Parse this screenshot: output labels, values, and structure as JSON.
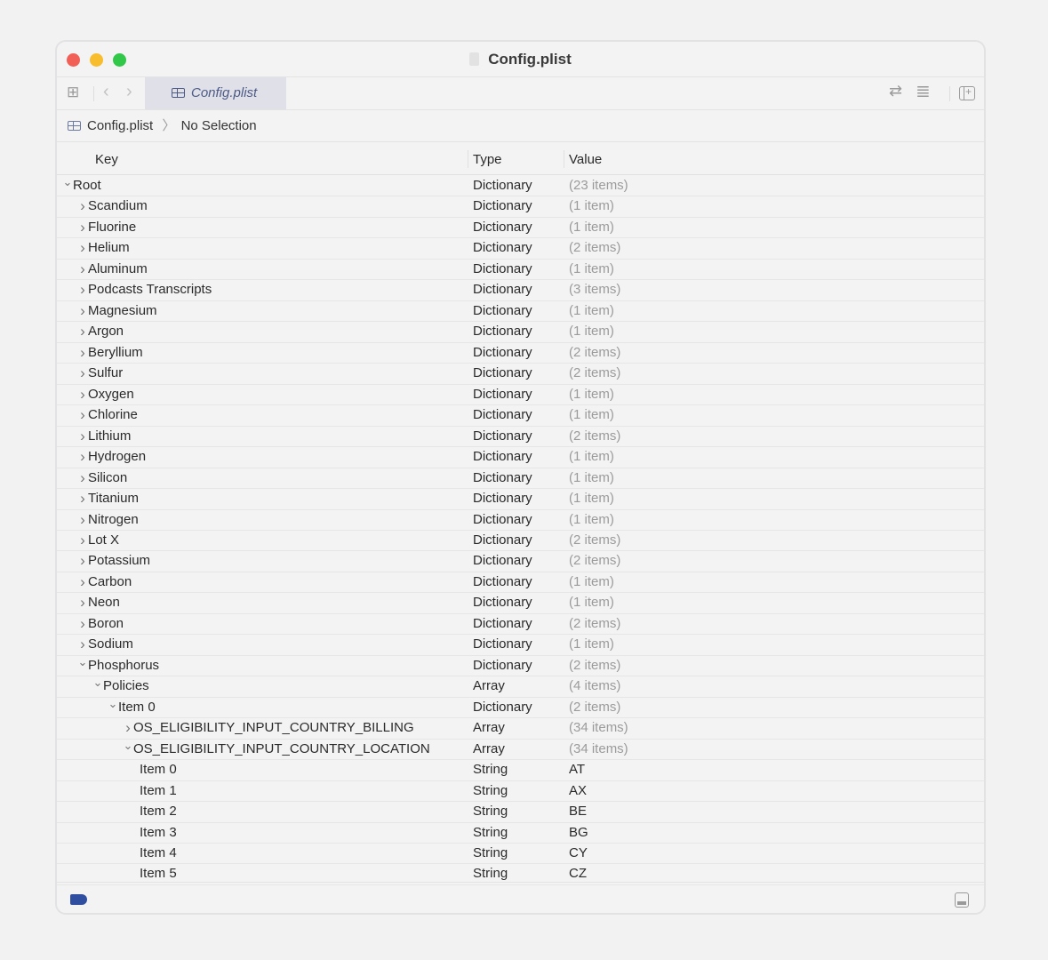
{
  "window": {
    "title": "Config.plist"
  },
  "toolbar": {
    "tab_label": "Config.plist"
  },
  "breadcrumb": {
    "file": "Config.plist",
    "separator": "〉",
    "selection": "No Selection"
  },
  "columns": {
    "key": "Key",
    "type": "Type",
    "value": "Value"
  },
  "rows": [
    {
      "key": "Root",
      "level": 0,
      "expand": "open",
      "type": "Dictionary",
      "value": "(23 items)",
      "muted": true
    },
    {
      "key": "Scandium",
      "level": 1,
      "expand": "closed",
      "type": "Dictionary",
      "value": "(1 item)",
      "muted": true
    },
    {
      "key": "Fluorine",
      "level": 1,
      "expand": "closed",
      "type": "Dictionary",
      "value": "(1 item)",
      "muted": true
    },
    {
      "key": "Helium",
      "level": 1,
      "expand": "closed",
      "type": "Dictionary",
      "value": "(2 items)",
      "muted": true
    },
    {
      "key": "Aluminum",
      "level": 1,
      "expand": "closed",
      "type": "Dictionary",
      "value": "(1 item)",
      "muted": true
    },
    {
      "key": "Podcasts Transcripts",
      "level": 1,
      "expand": "closed",
      "type": "Dictionary",
      "value": "(3 items)",
      "muted": true
    },
    {
      "key": "Magnesium",
      "level": 1,
      "expand": "closed",
      "type": "Dictionary",
      "value": "(1 item)",
      "muted": true
    },
    {
      "key": "Argon",
      "level": 1,
      "expand": "closed",
      "type": "Dictionary",
      "value": "(1 item)",
      "muted": true
    },
    {
      "key": "Beryllium",
      "level": 1,
      "expand": "closed",
      "type": "Dictionary",
      "value": "(2 items)",
      "muted": true
    },
    {
      "key": "Sulfur",
      "level": 1,
      "expand": "closed",
      "type": "Dictionary",
      "value": "(2 items)",
      "muted": true
    },
    {
      "key": "Oxygen",
      "level": 1,
      "expand": "closed",
      "type": "Dictionary",
      "value": "(1 item)",
      "muted": true
    },
    {
      "key": "Chlorine",
      "level": 1,
      "expand": "closed",
      "type": "Dictionary",
      "value": "(1 item)",
      "muted": true
    },
    {
      "key": "Lithium",
      "level": 1,
      "expand": "closed",
      "type": "Dictionary",
      "value": "(2 items)",
      "muted": true
    },
    {
      "key": "Hydrogen",
      "level": 1,
      "expand": "closed",
      "type": "Dictionary",
      "value": "(1 item)",
      "muted": true
    },
    {
      "key": "Silicon",
      "level": 1,
      "expand": "closed",
      "type": "Dictionary",
      "value": "(1 item)",
      "muted": true
    },
    {
      "key": "Titanium",
      "level": 1,
      "expand": "closed",
      "type": "Dictionary",
      "value": "(1 item)",
      "muted": true
    },
    {
      "key": "Nitrogen",
      "level": 1,
      "expand": "closed",
      "type": "Dictionary",
      "value": "(1 item)",
      "muted": true
    },
    {
      "key": "Lot X",
      "level": 1,
      "expand": "closed",
      "type": "Dictionary",
      "value": "(2 items)",
      "muted": true
    },
    {
      "key": "Potassium",
      "level": 1,
      "expand": "closed",
      "type": "Dictionary",
      "value": "(2 items)",
      "muted": true
    },
    {
      "key": "Carbon",
      "level": 1,
      "expand": "closed",
      "type": "Dictionary",
      "value": "(1 item)",
      "muted": true
    },
    {
      "key": "Neon",
      "level": 1,
      "expand": "closed",
      "type": "Dictionary",
      "value": "(1 item)",
      "muted": true
    },
    {
      "key": "Boron",
      "level": 1,
      "expand": "closed",
      "type": "Dictionary",
      "value": "(2 items)",
      "muted": true
    },
    {
      "key": "Sodium",
      "level": 1,
      "expand": "closed",
      "type": "Dictionary",
      "value": "(1 item)",
      "muted": true
    },
    {
      "key": "Phosphorus",
      "level": 1,
      "expand": "open",
      "type": "Dictionary",
      "value": "(2 items)",
      "muted": true
    },
    {
      "key": "Policies",
      "level": 2,
      "expand": "open",
      "type": "Array",
      "value": "(4 items)",
      "muted": true
    },
    {
      "key": "Item 0",
      "level": 3,
      "expand": "open",
      "type": "Dictionary",
      "value": "(2 items)",
      "muted": true
    },
    {
      "key": "OS_ELIGIBILITY_INPUT_COUNTRY_BILLING",
      "level": 4,
      "expand": "closed",
      "type": "Array",
      "value": "(34 items)",
      "muted": true
    },
    {
      "key": "OS_ELIGIBILITY_INPUT_COUNTRY_LOCATION",
      "level": 4,
      "expand": "open",
      "type": "Array",
      "value": "(34 items)",
      "muted": true
    },
    {
      "key": "Item 0",
      "level": 5,
      "expand": "none",
      "type": "String",
      "value": "AT",
      "muted": false
    },
    {
      "key": "Item 1",
      "level": 5,
      "expand": "none",
      "type": "String",
      "value": "AX",
      "muted": false
    },
    {
      "key": "Item 2",
      "level": 5,
      "expand": "none",
      "type": "String",
      "value": "BE",
      "muted": false
    },
    {
      "key": "Item 3",
      "level": 5,
      "expand": "none",
      "type": "String",
      "value": "BG",
      "muted": false
    },
    {
      "key": "Item 4",
      "level": 5,
      "expand": "none",
      "type": "String",
      "value": "CY",
      "muted": false
    },
    {
      "key": "Item 5",
      "level": 5,
      "expand": "none",
      "type": "String",
      "value": "CZ",
      "muted": false
    }
  ],
  "colors": {
    "close": "#f25f57",
    "minimize": "#f8bd2d",
    "zoom": "#31c748",
    "accent": "#2f4ea0"
  }
}
